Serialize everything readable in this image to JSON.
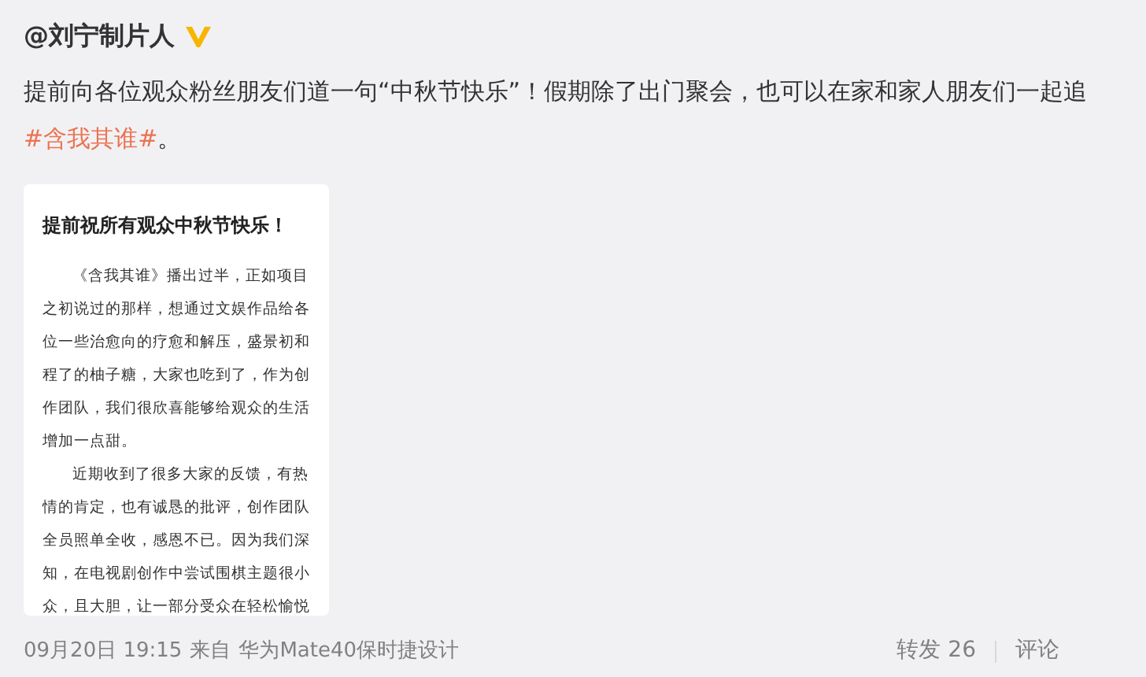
{
  "post": {
    "author": "@刘宁制片人",
    "verified": true,
    "text": [
      {
        "kind": "text",
        "text": "提前向各位观众粉丝朋友们道一句“中秋节快乐”！假期除了出门聚会，也可以在家和家人朋友们一起追"
      },
      {
        "kind": "topic",
        "text": "#含我其谁#"
      },
      {
        "kind": "text",
        "text": "。"
      }
    ],
    "image_card": {
      "title": "提前祝所有观众中秋节快乐！",
      "paragraphs": [
        "《含我其谁》播出过半，正如项目之初说过的那样，想通过文娱作品给各位一些治愈向的疗愈和解压，盛景初和程了的柚子糖，大家也吃到了，作为创作团队，我们很欣喜能够给观众的生活增加一点甜。",
        "近期收到了很多大家的反馈，有热情的肯定，也有诚恳的批评，创作团队全员照单全收，感恩不已。因为我们深知，在电视剧创作中尝试围棋主题很小众，且大胆，让一部分受众在轻松愉悦"
      ]
    },
    "time": "09月20日 19:15",
    "source_prefix": "来自",
    "source": "华为Mate40保时捷设计",
    "actions": [
      {
        "label": "转发 26"
      },
      {
        "label": "评论"
      }
    ]
  }
}
